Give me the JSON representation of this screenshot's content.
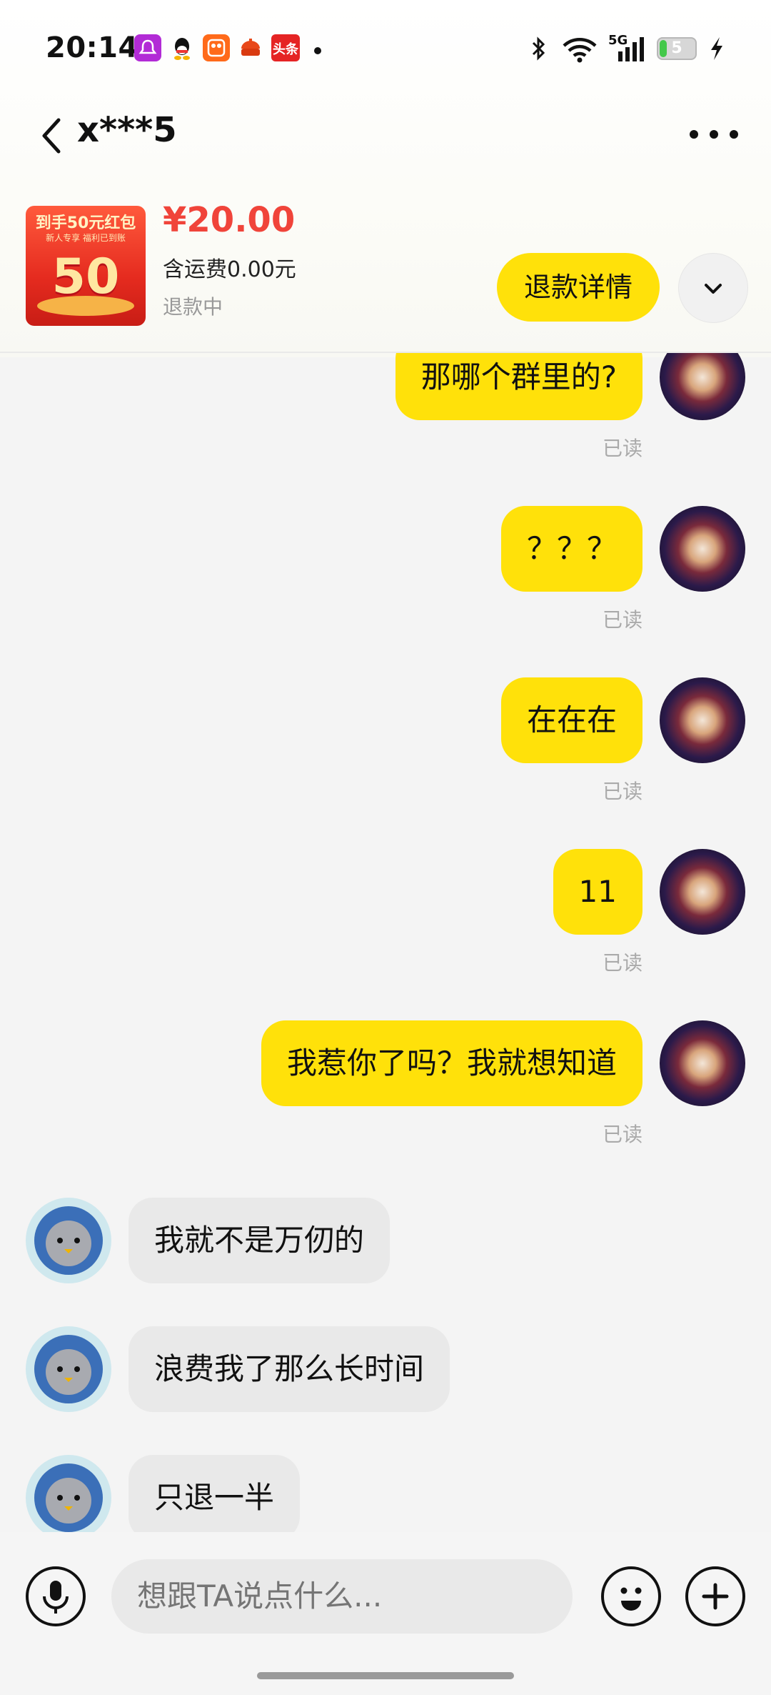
{
  "status_bar": {
    "time": "20:14",
    "notification_icons": [
      "bell-app-icon",
      "qq-icon",
      "video-app-icon",
      "shopping-app-icon",
      "toutiao-icon"
    ],
    "toutiao_label": "头条",
    "network": "5G",
    "battery": "5"
  },
  "header": {
    "title": "x***5"
  },
  "order_card": {
    "thumb_title": "到手50元红包",
    "thumb_subtitle": "新人专享 福利已到账",
    "thumb_number": "50",
    "price": "¥20.00",
    "shipping": "含运费0.00元",
    "status": "退款中",
    "refund_button": "退款详情"
  },
  "messages": [
    {
      "from": "me",
      "text": "那哪个群里的?",
      "read": "已读"
    },
    {
      "from": "me",
      "text": "？？？",
      "read": "已读"
    },
    {
      "from": "me",
      "text": "在在在",
      "read": "已读"
    },
    {
      "from": "me",
      "text": "11",
      "read": "已读"
    },
    {
      "from": "me",
      "text": "我惹你了吗？我就想知道",
      "read": "已读"
    },
    {
      "from": "ta",
      "text": "我就不是万仞的"
    },
    {
      "from": "ta",
      "text": "浪费我了那么长时间"
    },
    {
      "from": "ta",
      "text": "只退一半"
    }
  ],
  "input": {
    "placeholder": "想跟TA说点什么..."
  },
  "colors": {
    "accent_yellow": "#ffe10a",
    "price_red": "#f0443a"
  }
}
